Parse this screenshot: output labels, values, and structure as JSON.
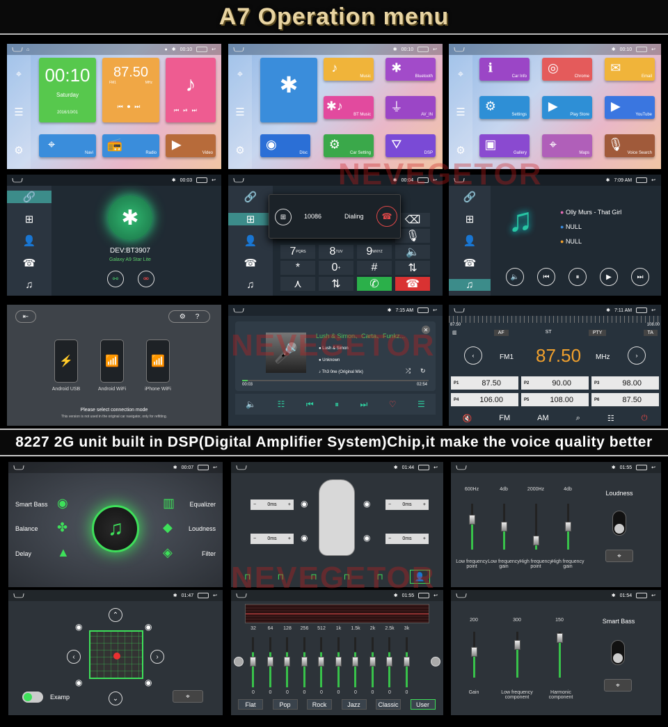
{
  "banner_top": "A7 Operation menu",
  "banner_mid": "8227 2G unit built in DSP(Digital Amplifier System)Chip,it make the voice quality better",
  "watermark": "NEVEGETOR",
  "status": {
    "t1": "00:10",
    "t2": "00:10",
    "t3": "00:10",
    "t4": "00:03",
    "t5": "00:04",
    "t6": "7:09 AM",
    "t8": "7:15 AM",
    "t9": "7:11 AM",
    "t10": "00:07",
    "t11": "01:44",
    "t12": "01:55",
    "t13": "01:47",
    "t14": "01:55",
    "t15": "01:54"
  },
  "home1": {
    "clock": "00:10",
    "day": "Saturday",
    "date": "2016/10/01",
    "radio_freq": "87.50",
    "radio_band": "FM1",
    "radio_unit": "MHz",
    "apps": [
      "Navi",
      "Radio",
      "Video"
    ]
  },
  "home2": {
    "apps": [
      "Music",
      "Bluetooth",
      "BT Music",
      "AV_IN",
      "Disc",
      "Car Setting",
      "DSP"
    ]
  },
  "home3": {
    "apps": [
      "Car Info",
      "Chrome",
      "Email",
      "Settings",
      "Play Store",
      "YouTube",
      "Gallery",
      "Maps",
      "Voice Search"
    ]
  },
  "bt": {
    "device": "DEV:BT3907",
    "phone": "Galaxy A9 Star Lite"
  },
  "dial": {
    "number": "10086",
    "state": "Dialing",
    "keys": [
      "7",
      "8",
      "9",
      "*",
      "0",
      "#"
    ],
    "subkeys": [
      "PQRS",
      "TUV",
      "WXYZ",
      "",
      "+",
      ""
    ]
  },
  "btmusic": {
    "tracks": [
      "Olly Murs - That Girl",
      "NULL",
      "NULL"
    ]
  },
  "connect": {
    "devices": [
      "Android USB",
      "Android WiFi",
      "iPhone WiFi"
    ],
    "title": "Please select connection mode",
    "note": "This version is not used in the original car navigator, only for refitting."
  },
  "music": {
    "artist": "Lush & Simon、Carta、Funkz...",
    "line1": "Lush & Simon",
    "line2": "Unknown",
    "line3": "Th3 0ne (Original Mix)",
    "elapsed": "00:03",
    "total": "02:54"
  },
  "radio": {
    "scale_min": "87.50",
    "scale_max": "108.00",
    "tags": [
      "AF",
      "ST",
      "PTY",
      "TA"
    ],
    "band": "FM1",
    "freq": "87.50",
    "unit": "MHz",
    "presets": [
      [
        "P1",
        "87.50"
      ],
      [
        "P2",
        "90.00"
      ],
      [
        "P3",
        "98.00"
      ],
      [
        "P4",
        "106.00"
      ],
      [
        "P5",
        "108.00"
      ],
      [
        "P6",
        "87.50"
      ]
    ],
    "bottom": [
      "FM",
      "AM"
    ]
  },
  "dsp": {
    "left": [
      "Smart Bass",
      "Balance",
      "Delay"
    ],
    "right": [
      "Equalizer",
      "Loudness",
      "Filter"
    ]
  },
  "delay": {
    "v1": "0ms",
    "v2": "0ms",
    "v3": "0ms",
    "v4": "0ms"
  },
  "filter": {
    "top": [
      "600Hz",
      "4db",
      "2000Hz",
      "4db"
    ],
    "bottom": [
      "Low frequency point",
      "Low frequency gain",
      "High frequency point",
      "High frequency gain"
    ],
    "loud": "Loudness"
  },
  "balance": {
    "examp": "Examp"
  },
  "eq": {
    "bands": [
      "32",
      "64",
      "128",
      "256",
      "512",
      "1k",
      "1.5k",
      "2k",
      "2.5k",
      "3k"
    ],
    "vals": [
      "0",
      "0",
      "0",
      "0",
      "0",
      "0",
      "0",
      "0",
      "0",
      "0"
    ],
    "presets": [
      "Flat",
      "Pop",
      "Rock",
      "Jazz",
      "Classic",
      "User"
    ]
  },
  "bass": {
    "top": [
      "200",
      "300",
      "150"
    ],
    "bottom": [
      "Gain",
      "Low frequency component",
      "Harmonic component"
    ],
    "title": "Smart Bass"
  }
}
